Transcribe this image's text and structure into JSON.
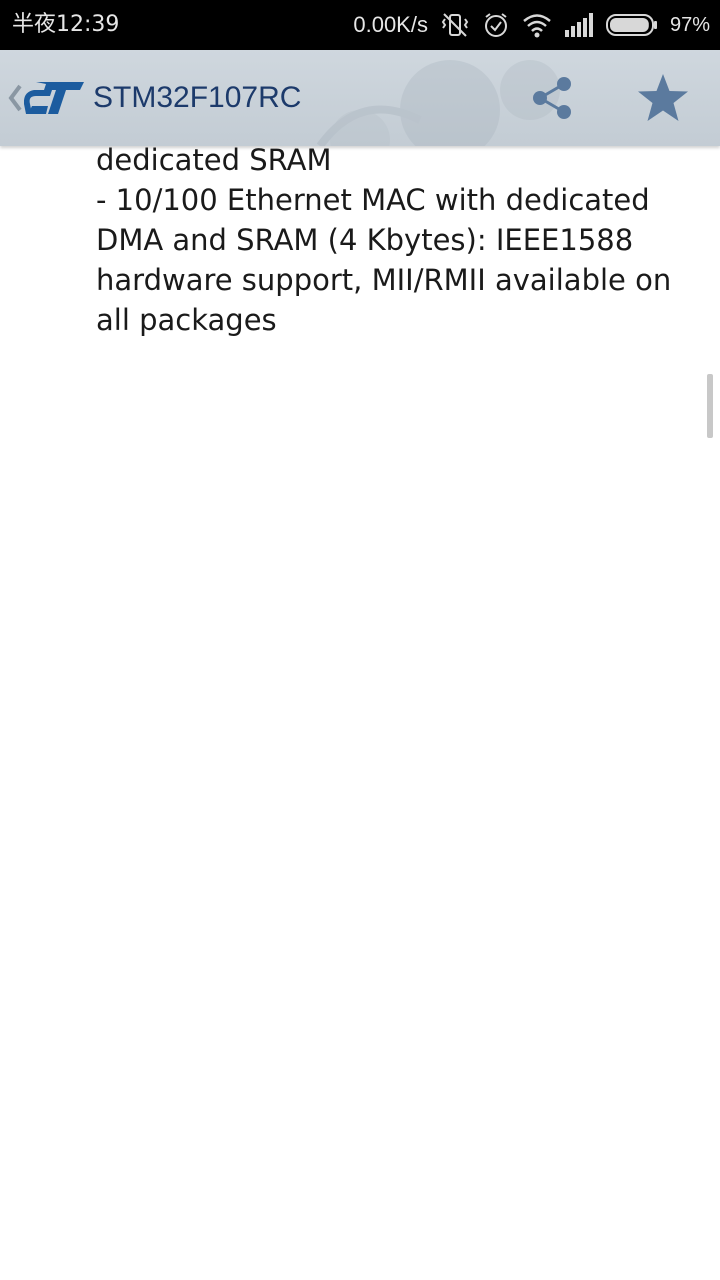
{
  "status_bar": {
    "time": "半夜12:39",
    "net_speed": "0.00K/s",
    "battery": "97%",
    "battery_level": 0.97,
    "icons": [
      "vibrate-off-icon",
      "alarm-icon",
      "wifi-icon",
      "signal-icon",
      "battery-icon"
    ]
  },
  "app_bar": {
    "title": "STM32F107RC",
    "logo": "st-logo",
    "icons": [
      "back-icon",
      "share-icon",
      "star-icon"
    ],
    "accent_color": "#1c3a6b",
    "icon_color": "#5b7a9e"
  },
  "content": {
    "lines": [
      "dedicated SRAM",
      "- 10/100 Ethernet MAC with dedicated",
      "DMA and SRAM (4 Kbytes): IEEE1588",
      "hardware support, MII/RMII available on",
      "all packages"
    ]
  }
}
